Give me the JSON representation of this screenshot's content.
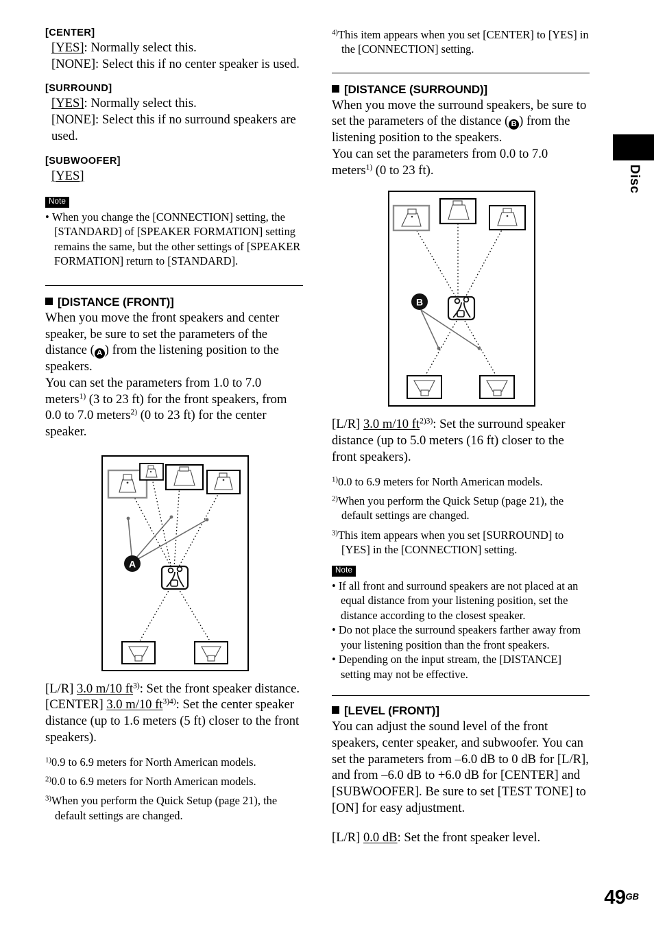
{
  "page": {
    "number": "49",
    "suffix": "GB"
  },
  "side_tab": {
    "label": "Disc"
  },
  "left_column": {
    "center": {
      "heading": "[CENTER]",
      "line1_value": "[YES]",
      "line1_rest": ": Normally select this.",
      "line2": "[NONE]: Select this if no center speaker is used."
    },
    "surround": {
      "heading": "[SURROUND]",
      "line1_value": "[YES]",
      "line1_rest": ": Normally select this.",
      "line2": "[NONE]: Select this if no surround speakers are used."
    },
    "subwoofer": {
      "heading": "[SUBWOOFER]",
      "value": "[YES]"
    },
    "note": {
      "label": "Note",
      "items": [
        "When you change the [CONNECTION] setting, the [STANDARD] of [SPEAKER FORMATION] setting remains the same, but the other settings of [SPEAKER FORMATION] return to [STANDARD]."
      ]
    },
    "distance_front": {
      "heading": "[DISTANCE (FRONT)]",
      "para1_a": "When you move the front speakers and center speaker, be sure to set the parameters of the distance (",
      "para1_marker": "A",
      "para1_b": ") from the listening position to the speakers.",
      "para2_a": "You can set the parameters from 1.0 to 7.0 meters",
      "para2_sup1": "1)",
      "para2_b": " (3 to 23 ft) for the front speakers, from 0.0 to 7.0 meters",
      "para2_sup2": "2)",
      "para2_c": " (0 to 23 ft) for the center speaker.",
      "lr_label": "[L/R] ",
      "lr_value": "3.0 m/10 ft",
      "lr_sup": "3)",
      "lr_rest": ": Set the front speaker distance.",
      "center_label": "[CENTER] ",
      "center_value": "3.0 m/10 ft",
      "center_sup": "3)4)",
      "center_rest": ": Set the center speaker distance (up to 1.6 meters (5 ft) closer to the front speakers).",
      "footnotes": [
        {
          "marker": "1)",
          "text": "0.9 to 6.9 meters for North American models."
        },
        {
          "marker": "2)",
          "text": "0.0 to 6.9 meters for North American models."
        },
        {
          "marker": "3)",
          "text": "When you perform the Quick Setup (page 21), the default settings are changed."
        }
      ]
    },
    "diagram": {
      "marker": "A",
      "icons": [
        "front-left-speaker",
        "center-speaker-small",
        "center-speaker",
        "front-right-speaker",
        "listening-position",
        "surround-left-speaker",
        "surround-right-speaker"
      ]
    }
  },
  "right_column": {
    "footnote_top": {
      "marker": "4)",
      "text": "This item appears when you set [CENTER] to [YES] in the [CONNECTION] setting."
    },
    "distance_surround": {
      "heading": "[DISTANCE (SURROUND)]",
      "para1_a": "When you move the surround speakers, be sure to set the parameters of the distance (",
      "para1_marker": "B",
      "para1_b": ") from the listening position to the speakers.",
      "para2_a": "You can set the parameters from 0.0 to 7.0 meters",
      "para2_sup": "1)",
      "para2_b": " (0 to 23 ft).",
      "lr_label": "[L/R] ",
      "lr_value": "3.0 m/10 ft",
      "lr_sup": "2)3)",
      "lr_rest": ": Set the surround speaker distance (up to 5.0 meters (16 ft) closer to the front speakers).",
      "footnotes": [
        {
          "marker": "1)",
          "text": "0.0 to 6.9 meters for North American models."
        },
        {
          "marker": "2)",
          "text": "When you perform the Quick Setup (page 21), the default settings are changed."
        },
        {
          "marker": "3)",
          "text": "This item appears when you set [SURROUND] to [YES] in the [CONNECTION] setting."
        }
      ],
      "note": {
        "label": "Note",
        "items": [
          "If all front and surround speakers are not placed at an equal distance from your listening position, set the distance according to the closest speaker.",
          "Do not place the surround speakers farther away from your listening position than the front speakers.",
          "Depending on the input stream, the [DISTANCE] setting may not be effective."
        ]
      }
    },
    "level_front": {
      "heading": "[LEVEL (FRONT)]",
      "para1": "You can adjust the sound level of the front speakers, center speaker, and subwoofer. You can set the parameters from –6.0 dB to 0 dB for [L/R], and from –6.0 dB to +6.0 dB for [CENTER] and [SUBWOOFER]. Be sure to set [TEST TONE] to [ON] for easy adjustment.",
      "lr_label": "[L/R] ",
      "lr_value": "0.0 dB",
      "lr_rest": ": Set the front speaker level."
    },
    "diagram": {
      "marker": "B",
      "icons": [
        "front-left-speaker",
        "center-speaker",
        "front-right-speaker",
        "listening-position",
        "surround-left-speaker",
        "surround-right-speaker"
      ]
    }
  }
}
